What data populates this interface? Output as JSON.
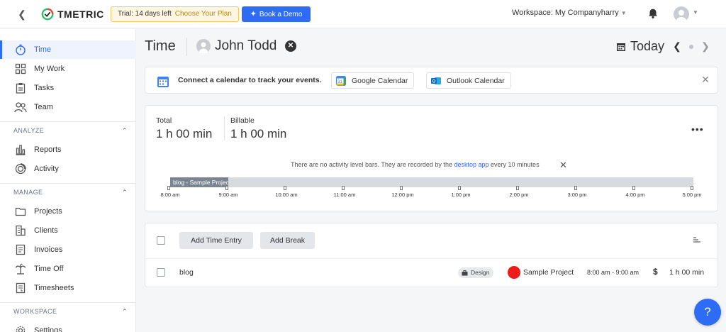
{
  "topbar": {
    "logo_text": "TMETRIC",
    "trial_text": "Trial: 14 days left",
    "trial_link": "Choose Your Plan",
    "demo_label": "Book a Demo",
    "workspace_label": "Workspace: My Companyharry"
  },
  "sidebar": {
    "items": [
      {
        "label": "Time",
        "icon": "stopwatch-icon"
      },
      {
        "label": "My Work",
        "icon": "grid-icon"
      },
      {
        "label": "Tasks",
        "icon": "clipboard-icon"
      },
      {
        "label": "Team",
        "icon": "team-icon"
      }
    ],
    "analyze": {
      "heading": "ANALYZE",
      "items": [
        {
          "label": "Reports",
          "icon": "bar-chart-icon"
        },
        {
          "label": "Activity",
          "icon": "activity-ring-icon"
        }
      ]
    },
    "manage": {
      "heading": "MANAGE",
      "items": [
        {
          "label": "Projects",
          "icon": "folder-icon"
        },
        {
          "label": "Clients",
          "icon": "building-icon"
        },
        {
          "label": "Invoices",
          "icon": "invoice-icon"
        },
        {
          "label": "Time Off",
          "icon": "palm-tree-icon"
        },
        {
          "label": "Timesheets",
          "icon": "timesheet-icon"
        }
      ]
    },
    "workspace": {
      "heading": "WORKSPACE",
      "items": [
        {
          "label": "Settings",
          "icon": "gear-icon"
        }
      ]
    }
  },
  "header": {
    "title": "Time",
    "user_name": "John Todd",
    "date_label": "Today"
  },
  "banner": {
    "text": "Connect a calendar to track your events.",
    "google_label": "Google Calendar",
    "outlook_label": "Outlook Calendar"
  },
  "summary": {
    "total_label": "Total",
    "total_value": "1 h 00 min",
    "billable_label": "Billable",
    "billable_value": "1 h 00 min",
    "note_prefix": "There are no activity level bars. They are recorded by the",
    "note_link": "desktop app",
    "note_suffix": "every 10 minutes",
    "timeline_entry": "blog - Sample Project",
    "ticks": [
      "8:00 am",
      "9:00 am",
      "10:00 am",
      "11:00 am",
      "12:00 pm",
      "1:00 pm",
      "2:00 pm",
      "3:00 pm",
      "4:00 pm",
      "5:00 pm"
    ]
  },
  "entries": {
    "add_time_label": "Add Time Entry",
    "add_break_label": "Add Break",
    "rows": [
      {
        "description": "blog",
        "tag": "Design",
        "project": "Sample Project",
        "project_color": "#f01c1c",
        "time_range": "8:00 am - 9:00 am",
        "billable_symbol": "$",
        "duration": "1 h 00 min"
      }
    ]
  },
  "help": {
    "label": "?"
  },
  "colors": {
    "accent": "#2f6cf6",
    "trial_border": "#f1c85f",
    "project": "#f01c1c"
  }
}
